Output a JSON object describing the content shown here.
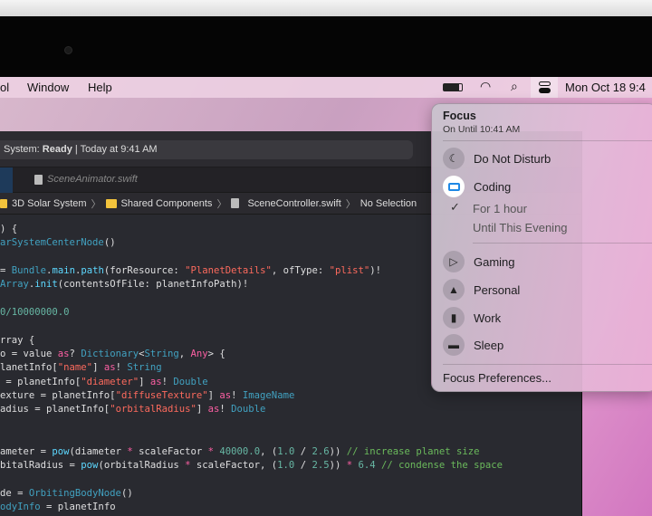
{
  "menubar": {
    "items": [
      "ol",
      "Window",
      "Help"
    ],
    "clock": "Mon Oct 18  9:4"
  },
  "xcode": {
    "status_prefix": "System: ",
    "status_state": "Ready",
    "status_suffix": " | Today at 9:41 AM",
    "tab": "SceneAnimator.swift",
    "breadcrumb": [
      "3D Solar System",
      "Shared Components",
      "SceneController.swift",
      "No Selection"
    ],
    "code": [
      [
        [
          ") {",
          ""
        ]
      ],
      [
        [
          "arSystemCenterNode",
          "ty"
        ],
        [
          "()",
          ""
        ]
      ],
      [
        [
          "",
          ""
        ]
      ],
      [
        [
          "= ",
          ""
        ],
        [
          "Bundle",
          "ty"
        ],
        [
          ".",
          ""
        ],
        [
          "main",
          "t"
        ],
        [
          ".",
          ""
        ],
        [
          "path",
          "t"
        ],
        [
          "(forResource: ",
          ""
        ],
        [
          "\"PlanetDetails\"",
          "s"
        ],
        [
          ", ofType: ",
          ""
        ],
        [
          "\"plist\"",
          "s"
        ],
        [
          ")!",
          ""
        ]
      ],
      [
        [
          "Array",
          "ty"
        ],
        [
          ".",
          ""
        ],
        [
          "init",
          "t"
        ],
        [
          "(contentsOfFile: planetInfoPath)!",
          ""
        ]
      ],
      [
        [
          "",
          ""
        ]
      ],
      [
        [
          "0/10000000.0",
          "f"
        ]
      ],
      [
        [
          "",
          ""
        ]
      ],
      [
        [
          "rray {",
          ""
        ]
      ],
      [
        [
          "o = value ",
          ""
        ],
        [
          "as",
          "k"
        ],
        [
          "? ",
          ""
        ],
        [
          "Dictionary",
          "ty"
        ],
        [
          "<",
          ""
        ],
        [
          "String",
          "ty"
        ],
        [
          ", ",
          ""
        ],
        [
          "Any",
          "k"
        ],
        [
          "> {",
          ""
        ]
      ],
      [
        [
          "lanetInfo[",
          ""
        ],
        [
          "\"name\"",
          "s"
        ],
        [
          "] ",
          ""
        ],
        [
          "as",
          "k"
        ],
        [
          "! ",
          ""
        ],
        [
          "String",
          "ty"
        ]
      ],
      [
        [
          " = planetInfo[",
          ""
        ],
        [
          "\"diameter\"",
          "s"
        ],
        [
          "] ",
          ""
        ],
        [
          "as",
          "k"
        ],
        [
          "! ",
          ""
        ],
        [
          "Double",
          "ty"
        ]
      ],
      [
        [
          "exture = planetInfo[",
          ""
        ],
        [
          "\"diffuseTexture\"",
          "s"
        ],
        [
          "] ",
          ""
        ],
        [
          "as",
          "k"
        ],
        [
          "! ",
          ""
        ],
        [
          "ImageName",
          "ty"
        ]
      ],
      [
        [
          "adius = planetInfo[",
          ""
        ],
        [
          "\"orbitalRadius\"",
          "s"
        ],
        [
          "] ",
          ""
        ],
        [
          "as",
          "k"
        ],
        [
          "! ",
          ""
        ],
        [
          "Double",
          "ty"
        ]
      ],
      [
        [
          "",
          ""
        ]
      ],
      [
        [
          "",
          ""
        ]
      ],
      [
        [
          "ameter = ",
          ""
        ],
        [
          "pow",
          "t"
        ],
        [
          "(diameter ",
          ""
        ],
        [
          "*",
          "k"
        ],
        [
          " scaleFactor ",
          ""
        ],
        [
          "*",
          "k"
        ],
        [
          " ",
          ""
        ],
        [
          "40000.0",
          "f"
        ],
        [
          ", (",
          ""
        ],
        [
          "1.0",
          "f"
        ],
        [
          " / ",
          ""
        ],
        [
          "2.6",
          "f"
        ],
        [
          ")) ",
          ""
        ],
        [
          "// increase planet size",
          "c"
        ]
      ],
      [
        [
          "bitalRadius = ",
          ""
        ],
        [
          "pow",
          "t"
        ],
        [
          "(orbitalRadius ",
          ""
        ],
        [
          "*",
          "k"
        ],
        [
          " scaleFactor, (",
          ""
        ],
        [
          "1.0",
          "f"
        ],
        [
          " / ",
          ""
        ],
        [
          "2.5",
          "f"
        ],
        [
          ")) ",
          ""
        ],
        [
          "*",
          "k"
        ],
        [
          " ",
          ""
        ],
        [
          "6.4",
          "f"
        ],
        [
          " ",
          ""
        ],
        [
          "// condense the space",
          "c"
        ]
      ],
      [
        [
          "",
          ""
        ]
      ],
      [
        [
          "de = ",
          ""
        ],
        [
          "OrbitingBodyNode",
          "ty"
        ],
        [
          "()",
          ""
        ]
      ],
      [
        [
          "odyInfo",
          "ty"
        ],
        [
          " = planetInfo",
          ""
        ]
      ]
    ]
  },
  "focus": {
    "title": "Focus",
    "subtitle": "On Until 10:41 AM",
    "modes": [
      {
        "label": "Do Not Disturb",
        "icon": "moon-icon"
      },
      {
        "label": "Coding",
        "icon": "monitor-icon",
        "active": true
      },
      {
        "label": "Gaming",
        "icon": "gamepad-icon"
      },
      {
        "label": "Personal",
        "icon": "person-icon"
      },
      {
        "label": "Work",
        "icon": "badge-icon"
      },
      {
        "label": "Sleep",
        "icon": "bed-icon"
      }
    ],
    "durations": [
      {
        "label": "For 1 hour",
        "checked": true
      },
      {
        "label": "Until This Evening"
      }
    ],
    "preferences": "Focus Preferences..."
  },
  "colors": {
    "accent": "#1e88e5"
  }
}
